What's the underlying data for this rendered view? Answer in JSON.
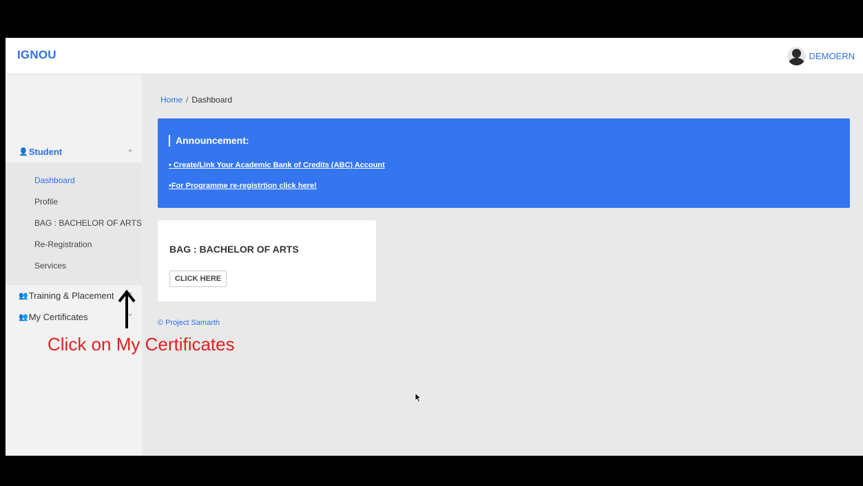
{
  "topbar": {
    "brand": "IGNOU",
    "user_name": "DEMOERN"
  },
  "sidebar": {
    "student_label": "Student",
    "student_items": [
      {
        "label": "Dashboard"
      },
      {
        "label": "Profile"
      },
      {
        "label": "BAG : BACHELOR OF ARTS"
      },
      {
        "label": "Re-Registration"
      },
      {
        "label": "Services"
      }
    ],
    "training_label": "Training & Placement",
    "certificates_label": "My Certificates"
  },
  "breadcrumb": {
    "home": "Home",
    "separator": "/",
    "current": "Dashboard"
  },
  "announcement": {
    "title": "Announcement:",
    "links": [
      "• Create/Link Your Academic Bank of Credits (ABC) Account",
      "•For Programme re-registrtion click here!"
    ]
  },
  "programme_card": {
    "title": "BAG : BACHELOR OF ARTS",
    "button": "CLICK HERE"
  },
  "footer": "© Project Samarth",
  "annotation": {
    "text": "Click on My Certificates"
  },
  "colors": {
    "accent": "#2f6fe4",
    "announcement_bg": "#3576f0",
    "annotation_text": "#e02020"
  }
}
